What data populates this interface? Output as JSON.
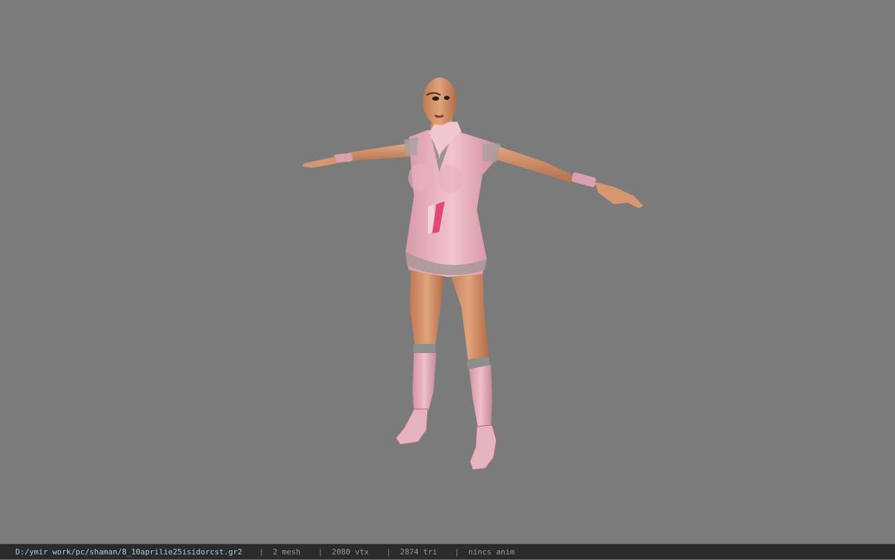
{
  "viewport": {
    "background_color": "#7b7b7b",
    "model_description": "pink-outfit-character-tpose"
  },
  "status_bar": {
    "file_path": "D:/ymir work/pc/shaman/8_10aprilie25isidorcst.gr2",
    "separator": "|",
    "mesh_count": "2 mesh",
    "vertex_count": "2080 vtx",
    "triangle_count": "2874 tri",
    "anim_status": "nincs anim",
    "path_color": "#9fd0ec",
    "text_color": "#9a9a9a",
    "bar_color": "#2b2b2b"
  }
}
